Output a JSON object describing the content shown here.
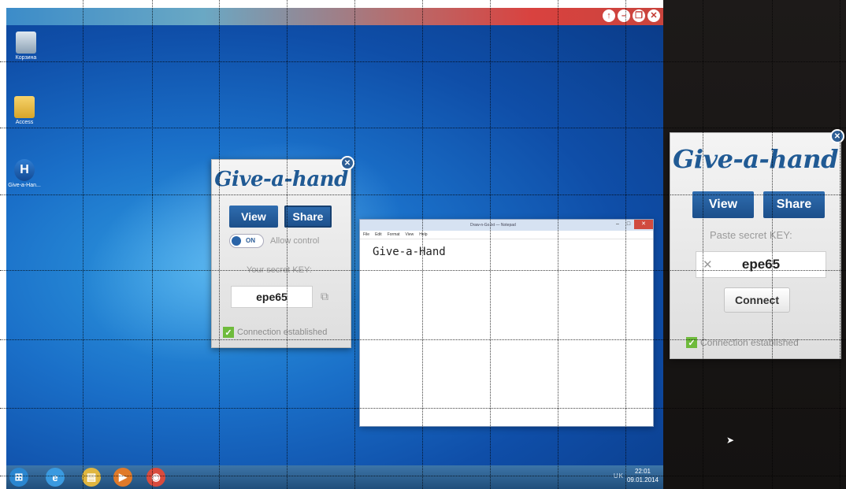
{
  "desktop": {
    "icons": [
      {
        "label": "Корзина",
        "icon": "recycle-bin-icon"
      },
      {
        "label": "Access",
        "icon": "folder-icon"
      },
      {
        "label": "Give-a-Han...",
        "icon": "give-a-hand-app-icon"
      }
    ],
    "taskbar": {
      "tray_text": "UK",
      "clock_time": "22:01",
      "clock_date": "09.01.2014"
    }
  },
  "notepad": {
    "title": "Draw-n-Go.txt — Notepad",
    "menu": [
      "File",
      "Edit",
      "Format",
      "View",
      "Help"
    ],
    "content": "Give-a-Hand"
  },
  "sharer_panel": {
    "logo": "Give-a-hand",
    "view_label": "View",
    "share_label": "Share",
    "toggle_label": "ON",
    "allow_control_label": "Allow control",
    "secret_key_label": "Your secret KEY:",
    "secret_key": "epe65",
    "status": "Connection established"
  },
  "viewer_panel": {
    "logo": "Give-a-hand",
    "view_label": "View",
    "share_label": "Share",
    "paste_key_label": "Paste secret KEY:",
    "clear_symbol": "✕",
    "secret_key": "epe65",
    "connect_label": "Connect",
    "status": "Connection established"
  },
  "colors": {
    "brand_blue": "#205a94",
    "button_blue": "#2f6db0",
    "status_green": "#6fbb3c"
  }
}
